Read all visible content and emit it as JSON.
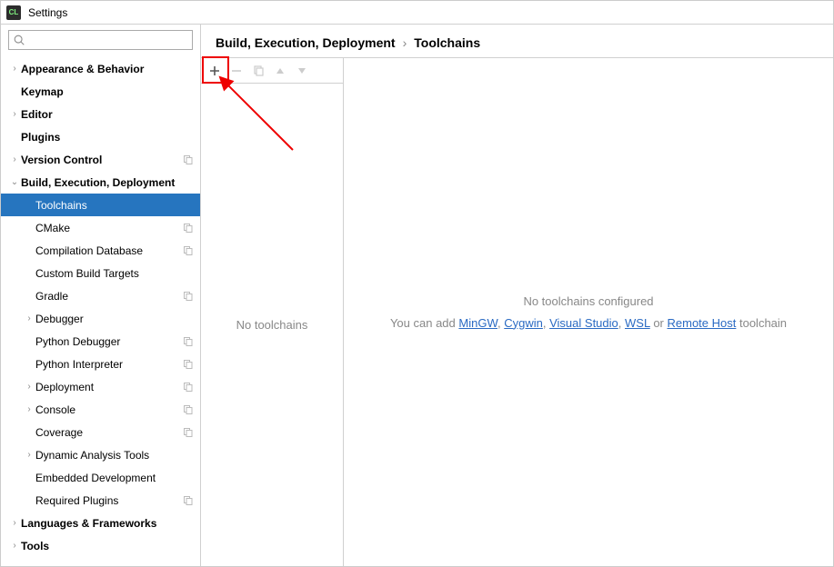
{
  "title": "Settings",
  "search": {
    "placeholder": ""
  },
  "breadcrumb": {
    "parent": "Build, Execution, Deployment",
    "current": "Toolchains"
  },
  "sidebar": {
    "items": [
      {
        "label": "Appearance & Behavior",
        "bold": true,
        "arrow": "collapsed",
        "level": 0
      },
      {
        "label": "Keymap",
        "bold": true,
        "arrow": "none",
        "level": 0
      },
      {
        "label": "Editor",
        "bold": true,
        "arrow": "collapsed",
        "level": 0
      },
      {
        "label": "Plugins",
        "bold": true,
        "arrow": "none",
        "level": 0
      },
      {
        "label": "Version Control",
        "bold": true,
        "arrow": "collapsed",
        "level": 0,
        "badge": true
      },
      {
        "label": "Build, Execution, Deployment",
        "bold": true,
        "arrow": "expanded",
        "level": 0
      },
      {
        "label": "Toolchains",
        "bold": false,
        "arrow": "none",
        "level": 1,
        "selected": true
      },
      {
        "label": "CMake",
        "bold": false,
        "arrow": "none",
        "level": 1,
        "badge": true
      },
      {
        "label": "Compilation Database",
        "bold": false,
        "arrow": "none",
        "level": 1,
        "badge": true
      },
      {
        "label": "Custom Build Targets",
        "bold": false,
        "arrow": "none",
        "level": 1
      },
      {
        "label": "Gradle",
        "bold": false,
        "arrow": "none",
        "level": 1,
        "badge": true
      },
      {
        "label": "Debugger",
        "bold": false,
        "arrow": "collapsed",
        "level": 1
      },
      {
        "label": "Python Debugger",
        "bold": false,
        "arrow": "none",
        "level": 1,
        "badge": true
      },
      {
        "label": "Python Interpreter",
        "bold": false,
        "arrow": "none",
        "level": 1,
        "badge": true
      },
      {
        "label": "Deployment",
        "bold": false,
        "arrow": "collapsed",
        "level": 1,
        "badge": true
      },
      {
        "label": "Console",
        "bold": false,
        "arrow": "collapsed",
        "level": 1,
        "badge": true
      },
      {
        "label": "Coverage",
        "bold": false,
        "arrow": "none",
        "level": 1,
        "badge": true
      },
      {
        "label": "Dynamic Analysis Tools",
        "bold": false,
        "arrow": "collapsed",
        "level": 1
      },
      {
        "label": "Embedded Development",
        "bold": false,
        "arrow": "none",
        "level": 1
      },
      {
        "label": "Required Plugins",
        "bold": false,
        "arrow": "none",
        "level": 1,
        "badge": true
      },
      {
        "label": "Languages & Frameworks",
        "bold": true,
        "arrow": "collapsed",
        "level": 0
      },
      {
        "label": "Tools",
        "bold": true,
        "arrow": "collapsed",
        "level": 0
      }
    ]
  },
  "list": {
    "empty_text": "No toolchains"
  },
  "detail": {
    "title_text": "No toolchains configured",
    "hint_prefix": "You can add ",
    "links": [
      "MinGW",
      "Cygwin",
      "Visual Studio",
      "WSL"
    ],
    "hint_or": " or ",
    "last_link": "Remote Host",
    "hint_suffix": " toolchain"
  }
}
